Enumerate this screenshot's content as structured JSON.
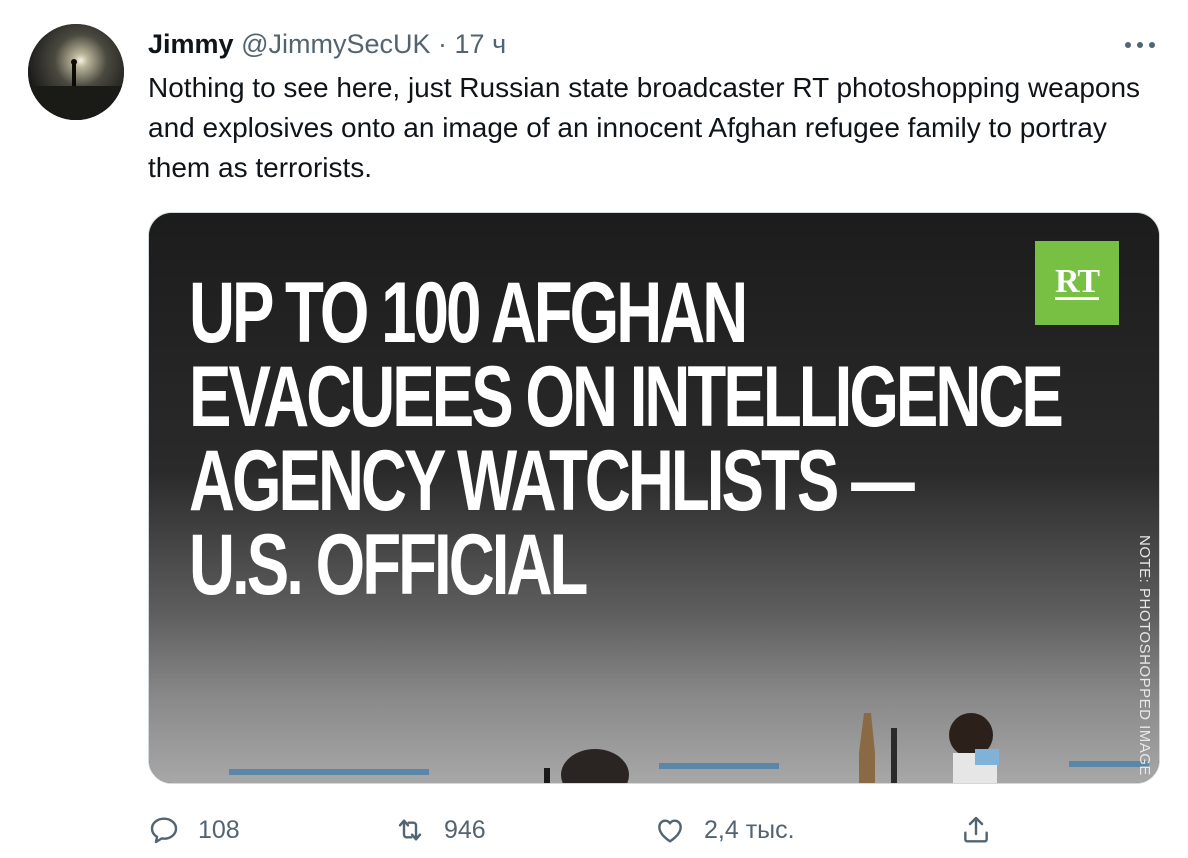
{
  "tweet": {
    "display_name": "Jimmy",
    "handle": "@JimmySecUK",
    "separator": "·",
    "time": "17 ч",
    "text": "Nothing to see here, just Russian state broadcaster RT photoshopping weapons and explosives onto an image of an innocent Afghan refugee family to portray them as terrorists."
  },
  "media": {
    "headline_lines": [
      "UP TO 100 AFGHAN",
      "EVACUEES ON INTELLIGENCE",
      "AGENCY WATCHLISTS —",
      "U.S. OFFICIAL"
    ],
    "logo_text": "RT",
    "logo_color": "#77c043",
    "side_note": "NOTE: PHOTOSHOPPED IMAGE"
  },
  "actions": {
    "reply_count": "108",
    "retweet_count": "946",
    "like_count": "2,4 тыс.",
    "icons": [
      "reply-icon",
      "retweet-icon",
      "like-icon",
      "share-icon"
    ]
  },
  "colors": {
    "text": "#0f1419",
    "secondary": "#536471"
  }
}
